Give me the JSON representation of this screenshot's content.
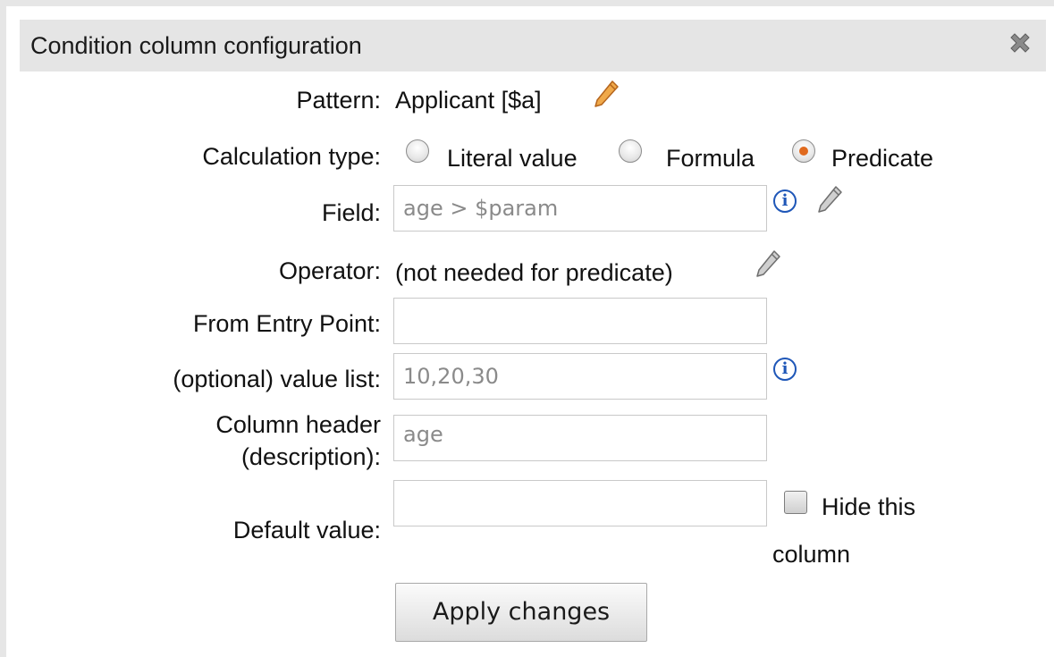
{
  "dialog": {
    "title": "Condition column configuration",
    "close_icon": "close-x-icon"
  },
  "form": {
    "pattern": {
      "label": "Pattern:",
      "value": "Applicant [$a]"
    },
    "calculation_type": {
      "label": "Calculation type:",
      "options": [
        {
          "label": "Literal value",
          "selected": false
        },
        {
          "label": "Formula",
          "selected": false
        },
        {
          "label": "Predicate",
          "selected": true
        }
      ]
    },
    "field": {
      "label": "Field:",
      "value": "age > $param"
    },
    "operator": {
      "label": "Operator:",
      "value": "(not needed for predicate)"
    },
    "entry_point": {
      "label": "From Entry Point:",
      "value": ""
    },
    "value_list": {
      "label": "(optional) value list:",
      "value": "10,20,30"
    },
    "column_header": {
      "label_line1": "Column header",
      "label_line2": "(description):",
      "value": "age"
    },
    "default_value": {
      "label": "Default value:",
      "value": ""
    },
    "hide_column": {
      "label_line1": "Hide this",
      "label_line2": "column",
      "checked": false
    },
    "apply_button": "Apply changes"
  },
  "colors": {
    "title_bar": "#e5e5e5",
    "radio_selected": "#e06a1e",
    "info_icon": "#1f57b8",
    "pencil_icon": "#e67e22"
  }
}
